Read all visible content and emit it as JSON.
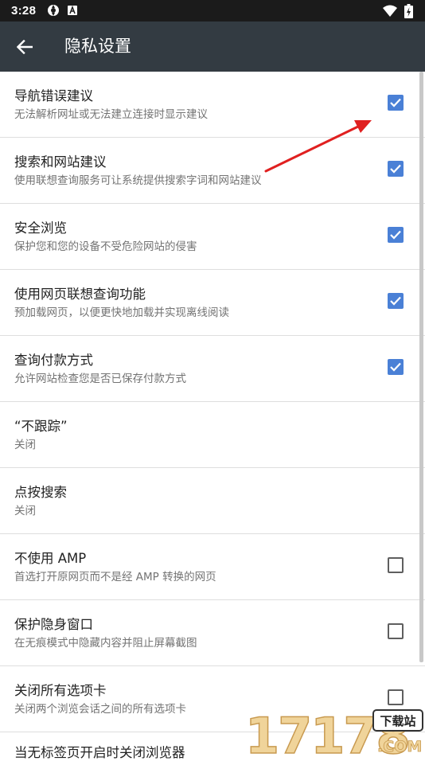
{
  "status_bar": {
    "time": "3:28"
  },
  "app_bar": {
    "title": "隐私设置"
  },
  "settings": [
    {
      "title": "导航错误建议",
      "summary": "无法解析网址或无法建立连接时显示建议",
      "control": "checkbox",
      "checked": true
    },
    {
      "title": "搜索和网站建议",
      "summary": "使用联想查询服务可让系统提供搜索字词和网站建议",
      "control": "checkbox",
      "checked": true
    },
    {
      "title": "安全浏览",
      "summary": "保护您和您的设备不受危险网站的侵害",
      "control": "checkbox",
      "checked": true
    },
    {
      "title": "使用网页联想查询功能",
      "summary": "预加载网页，以便更快地加载并实现离线阅读",
      "control": "checkbox",
      "checked": true
    },
    {
      "title": "查询付款方式",
      "summary": "允许网站检查您是否已保存付款方式",
      "control": "checkbox",
      "checked": true
    },
    {
      "title": "“不跟踪”",
      "summary": "关闭",
      "control": "none"
    },
    {
      "title": "点按搜索",
      "summary": "关闭",
      "control": "none"
    },
    {
      "title": "不使用 AMP",
      "summary": "首选打开原网页而不是经 AMP 转换的网页",
      "control": "checkbox",
      "checked": false
    },
    {
      "title": "保护隐身窗口",
      "summary": "在无痕模式中隐藏内容并阻止屏幕截图",
      "control": "checkbox",
      "checked": false
    },
    {
      "title": "关闭所有选项卡",
      "summary": "关闭两个浏览会话之间的所有选项卡",
      "control": "checkbox",
      "checked": false
    }
  ],
  "partial_setting": {
    "title": "当无标签页开启时关闭浏览器"
  },
  "watermark": {
    "number": "17178",
    "tag": "下载站",
    "domain": ".COM"
  },
  "colors": {
    "status_bar": "#1b1b1b",
    "app_bar": "#333b42",
    "checkbox_checked": "#4a80d6",
    "annotation_arrow": "#e02020"
  },
  "icons": {
    "back": "back-arrow-icon",
    "status_1": "sync-icon",
    "status_2": "a-icon",
    "wifi": "wifi-icon",
    "battery": "battery-charging-icon"
  }
}
